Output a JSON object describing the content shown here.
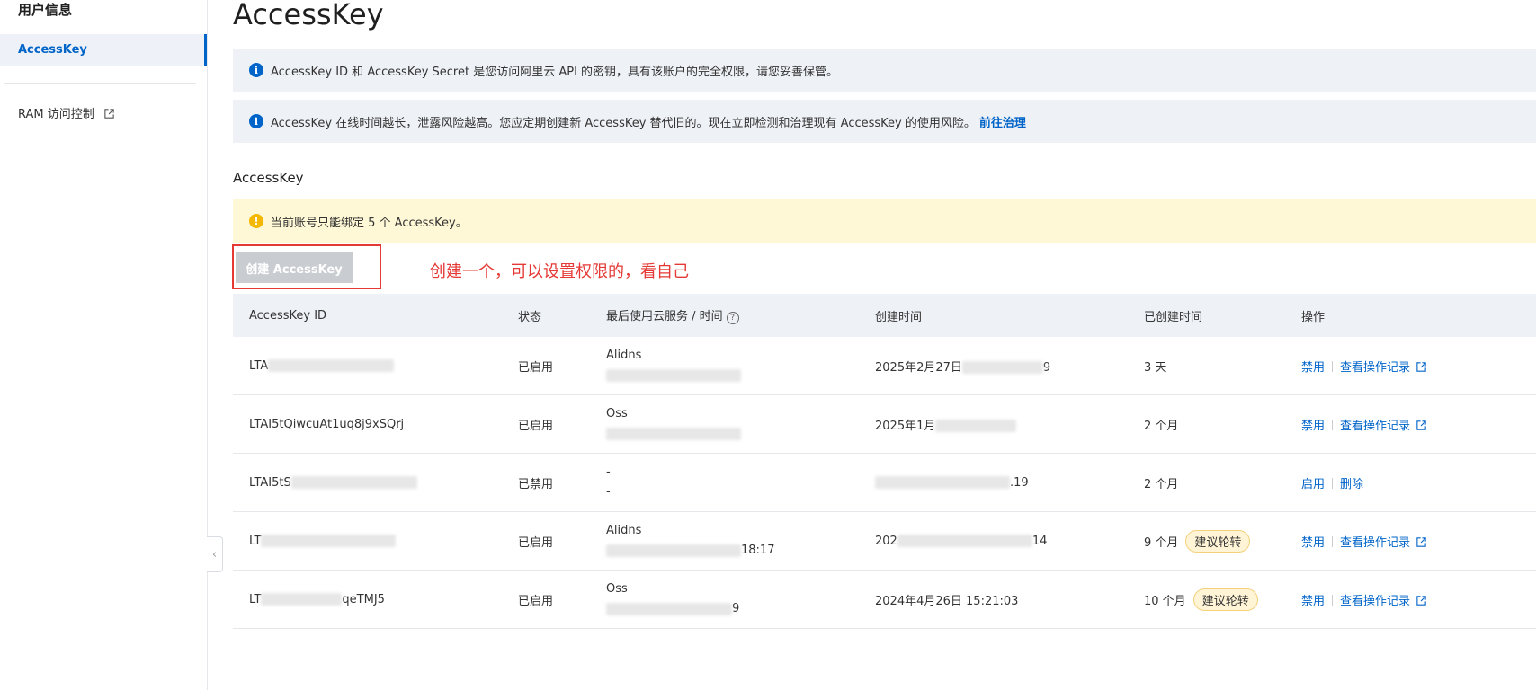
{
  "sidebar": {
    "group_title": "用户信息",
    "items": [
      {
        "label": "AccessKey",
        "active": true
      },
      {
        "label": "RAM 访问控制",
        "external": true
      }
    ]
  },
  "main": {
    "title": "AccessKey",
    "notices": [
      {
        "text": "AccessKey ID 和 AccessKey Secret 是您访问阿里云 API 的密钥，具有该账户的完全权限，请您妥善保管。"
      },
      {
        "text": "AccessKey 在线时间越长，泄露风险越高。您应定期创建新 AccessKey 替代旧的。现在立即检测和治理现有 AccessKey 的使用风险。",
        "link": "前往治理"
      }
    ],
    "section_title": "AccessKey",
    "warning": "当前账号只能绑定 5 个 AccessKey。",
    "create_button": "创建 AccessKey",
    "annotation": "创建一个，可以设置权限的，看自己"
  },
  "table": {
    "columns": [
      "AccessKey ID",
      "状态",
      "最后使用云服务 / 时间",
      "创建时间",
      "已创建时间",
      "操作"
    ],
    "rows": [
      {
        "id_prefix": "LTA",
        "id_suffix": "",
        "status": "已启用",
        "service": "Alidns",
        "time_suffix": "",
        "created_prefix": "2025年2月27日",
        "created_suffix": "9",
        "age": "3 天",
        "badge": "",
        "op1": "禁用",
        "op2": "查看操作记录",
        "op2_external": true
      },
      {
        "id_prefix": "LTAI5tQiwcuAt1uq8j9xSQrj",
        "id_suffix": "",
        "status": "已启用",
        "service": "Oss",
        "time_suffix": "",
        "created_prefix": "2025年1月",
        "created_suffix": "",
        "age": "2 个月",
        "badge": "",
        "op1": "禁用",
        "op2": "查看操作记录",
        "op2_external": true
      },
      {
        "id_prefix": "LTAI5tS",
        "id_suffix": "",
        "status": "已禁用",
        "service": "-",
        "time_suffix": "-",
        "created_prefix": "",
        "created_suffix": ".19",
        "age": "2 个月",
        "badge": "",
        "op1": "启用",
        "op2": "删除",
        "op2_external": false
      },
      {
        "id_prefix": "LT",
        "id_suffix": "",
        "status": "已启用",
        "service": "Alidns",
        "time_suffix": "18:17",
        "created_prefix": "202",
        "created_suffix": "14",
        "age": "9 个月",
        "badge": "建议轮转",
        "op1": "禁用",
        "op2": "查看操作记录",
        "op2_external": true
      },
      {
        "id_prefix": "LT",
        "id_suffix": "qeTMJ5",
        "status": "已启用",
        "service": "Oss",
        "time_suffix": "9",
        "created_prefix": "2024年4月26日 15:21:03",
        "created_suffix": "",
        "age": "10 个月",
        "badge": "建议轮转",
        "op1": "禁用",
        "op2": "查看操作记录",
        "op2_external": true
      }
    ]
  }
}
